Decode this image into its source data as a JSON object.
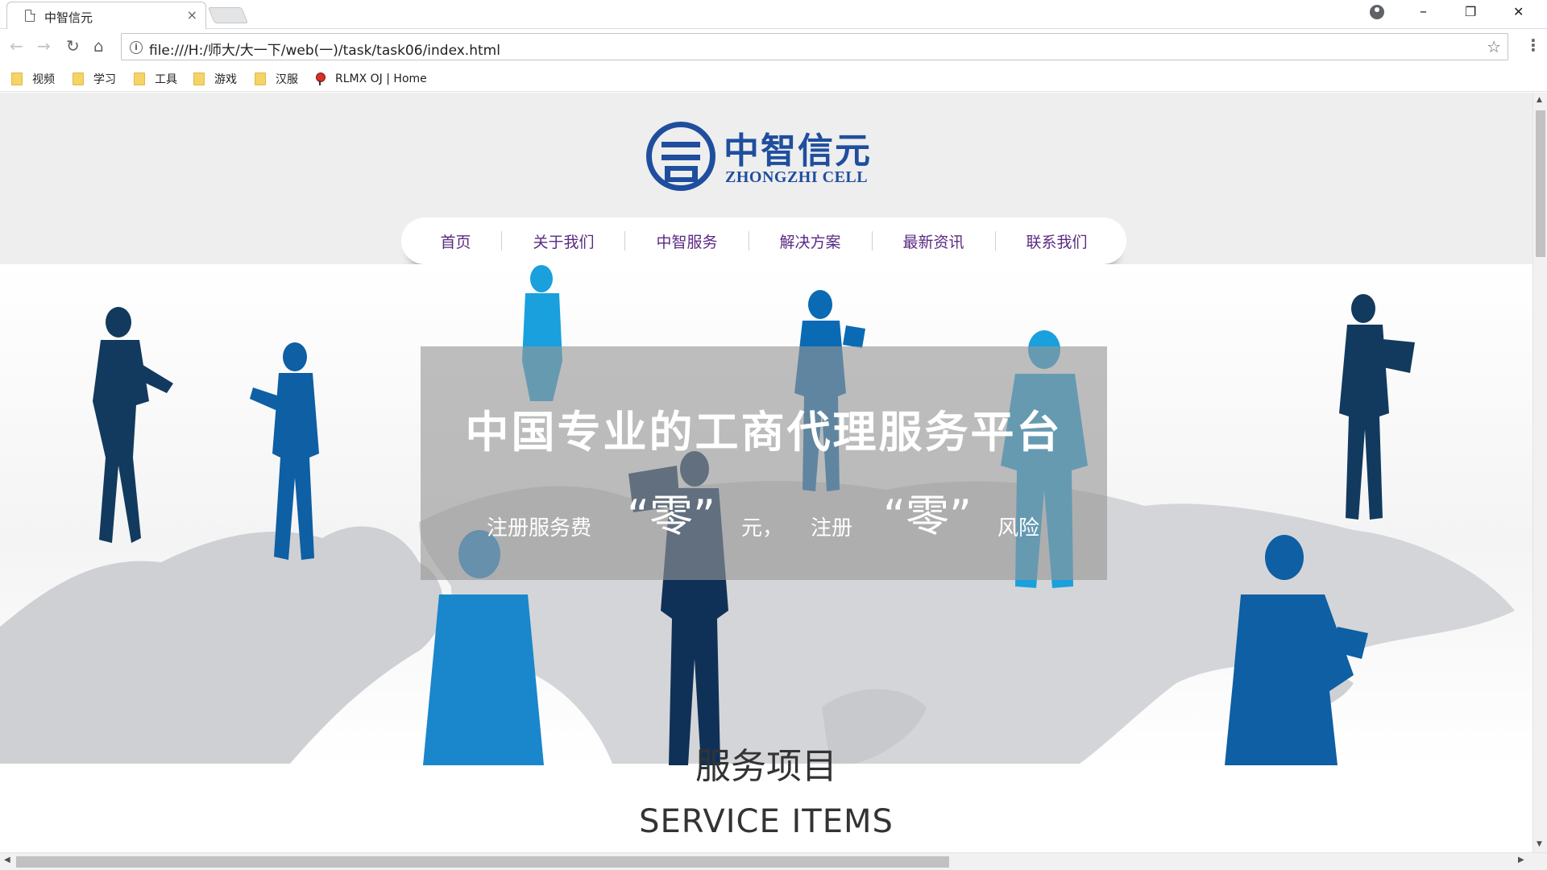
{
  "browser": {
    "tab_title": "中智信元",
    "tab_close": "×",
    "url": "file:///H:/师大/大一下/web(一)/task/task06/index.html",
    "window_controls": {
      "minimize": "–",
      "restore": "❐",
      "close": "✕"
    },
    "nav_icons": {
      "back": "back-arrow-icon",
      "forward": "forward-arrow-icon",
      "reload": "reload-icon",
      "home": "home-icon"
    },
    "bookmarks": [
      {
        "label": "视频",
        "icon": "folder-icon"
      },
      {
        "label": "学习",
        "icon": "folder-icon"
      },
      {
        "label": "工具",
        "icon": "folder-icon"
      },
      {
        "label": "游戏",
        "icon": "folder-icon"
      },
      {
        "label": "汉服",
        "icon": "folder-icon"
      },
      {
        "label": "RLMX OJ | Home",
        "icon": "site-favicon"
      }
    ]
  },
  "page": {
    "logo": {
      "cn": "中智信元",
      "en": "ZHONGZHI CELL",
      "color": "#1f4e9e"
    },
    "nav": [
      "首页",
      "关于我们",
      "中智服务",
      "解决方案",
      "最新资讯",
      "联系我们"
    ],
    "nav_color": "#5a2a82",
    "hero": {
      "title": "中国专业的工商代理服务平台",
      "subtitle": {
        "part1": "注册服务费",
        "zero1": "“零”",
        "part2": "元，",
        "part3": "注册",
        "zero2": "“零”",
        "part4": "风险"
      }
    },
    "section": {
      "title_cn": "服务项目",
      "title_en": "SERVICE ITEMS"
    }
  }
}
